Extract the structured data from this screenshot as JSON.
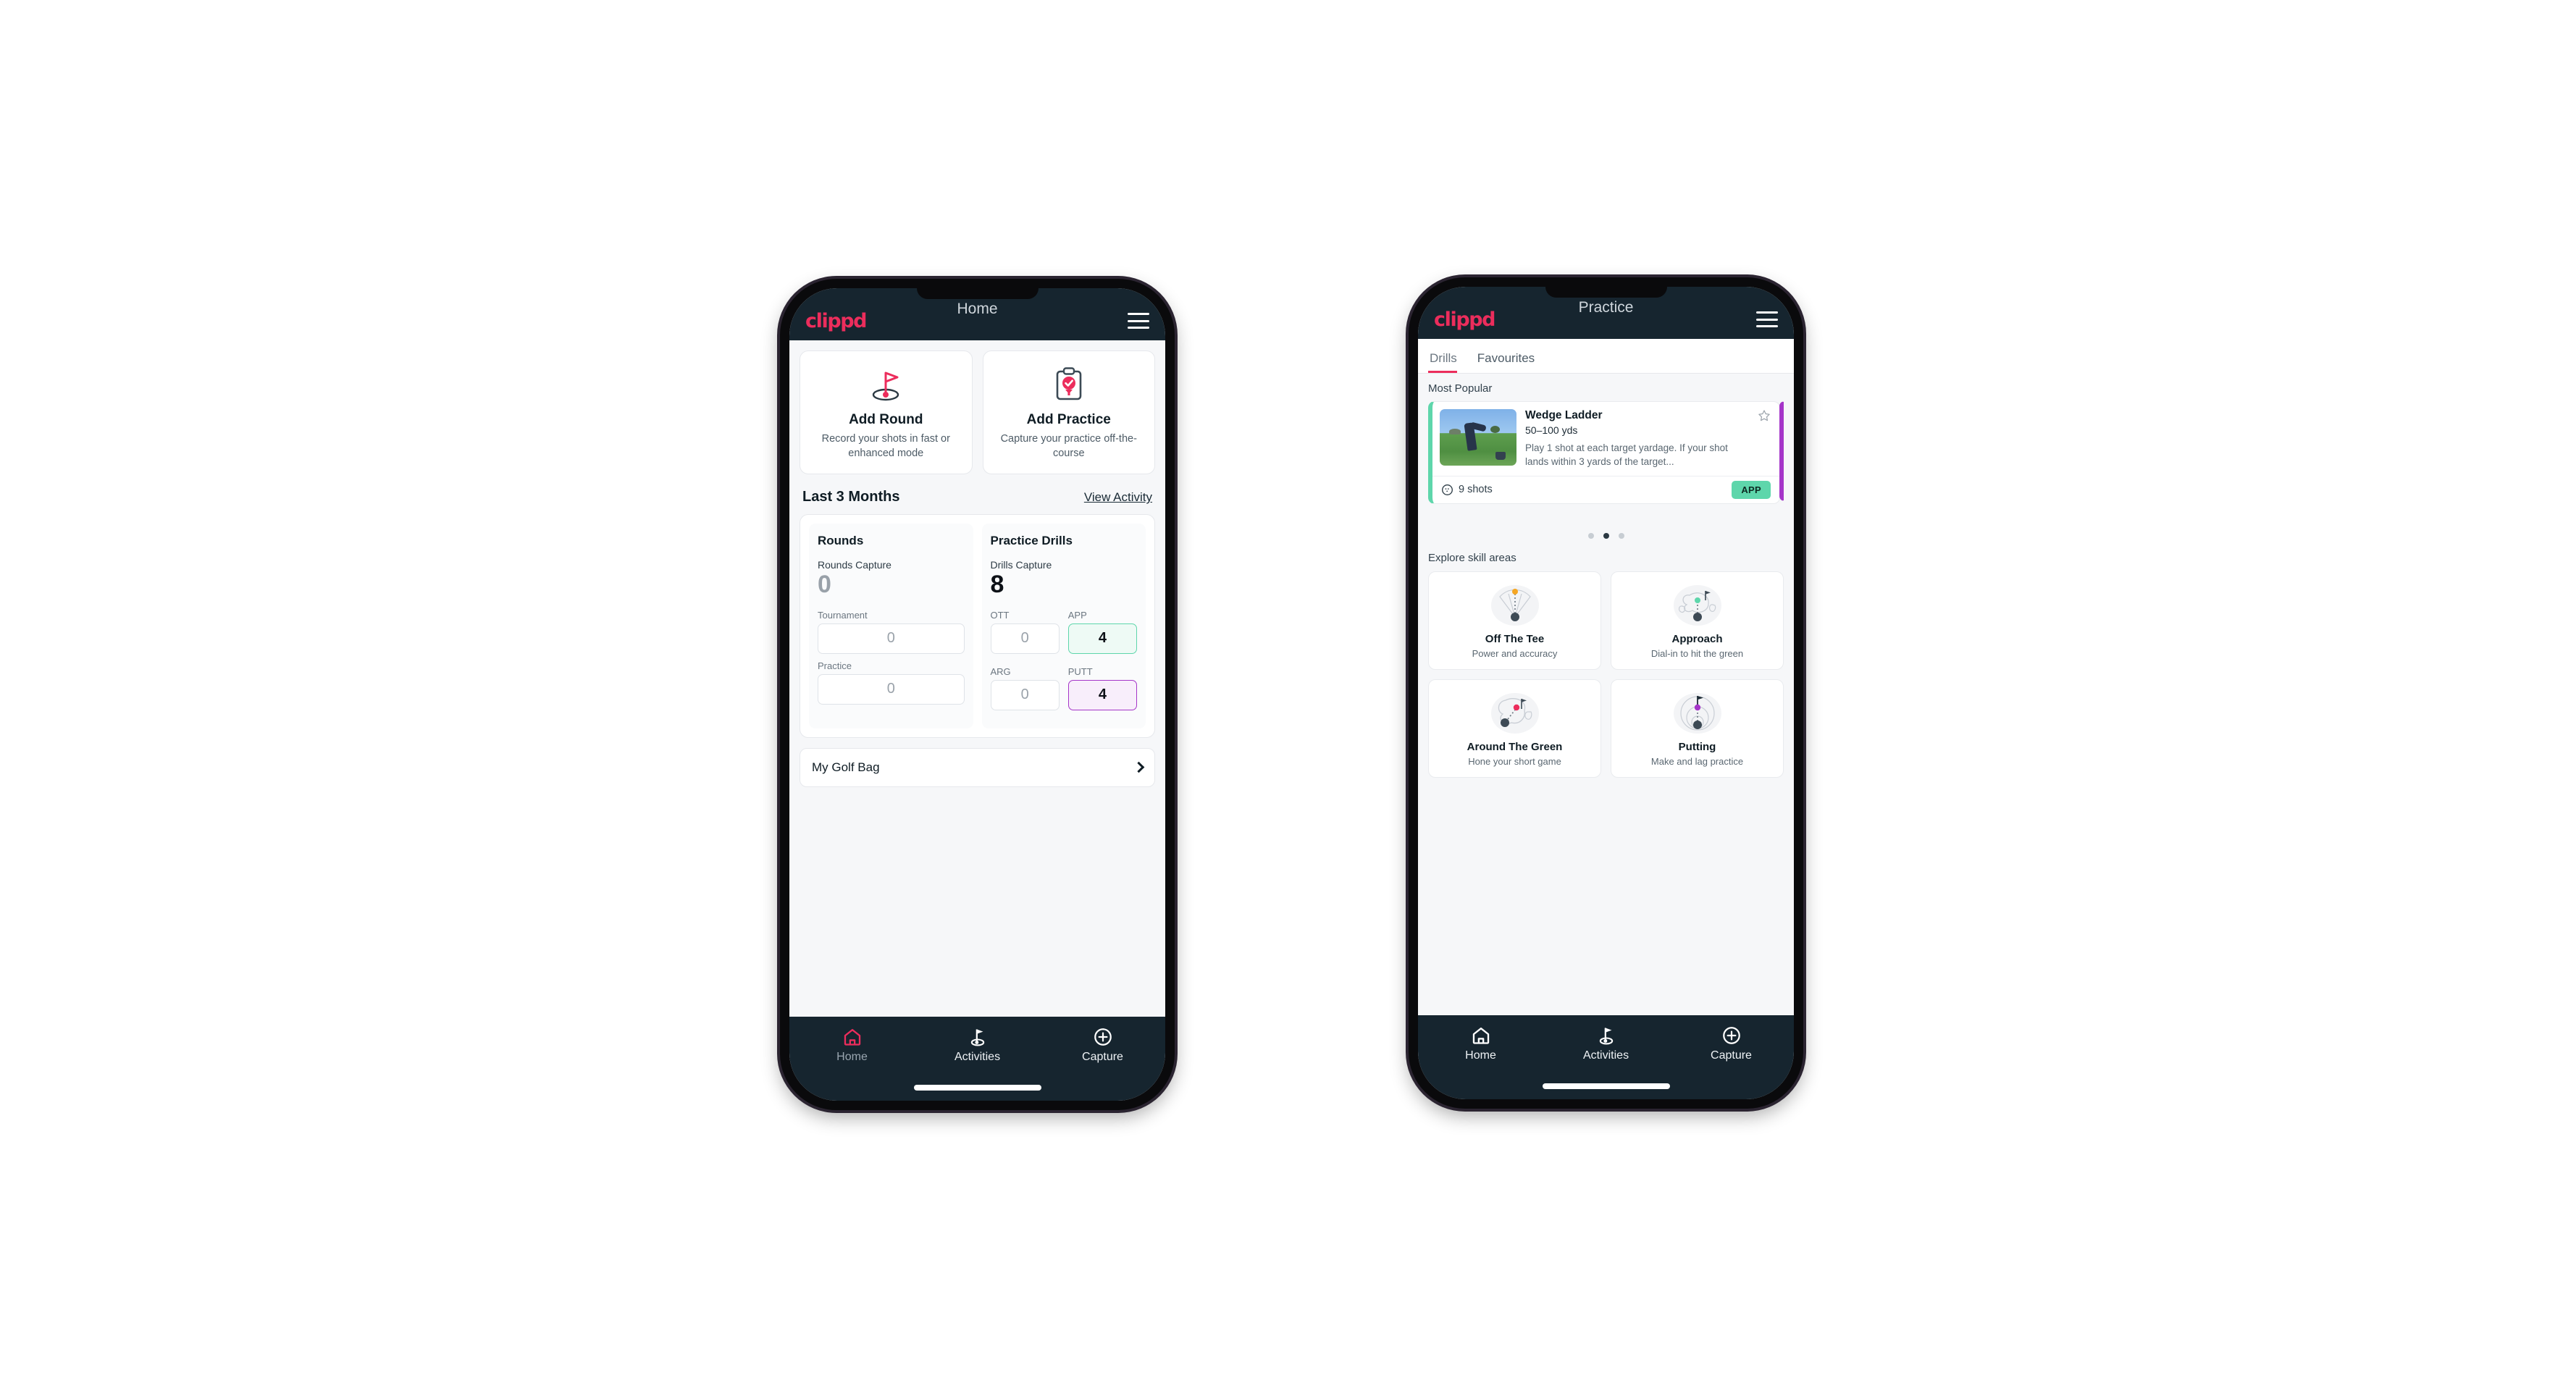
{
  "colors": {
    "brand_pink": "#ec2d5c",
    "appbar_dark": "#16252f",
    "accent_green": "#5ed6ab",
    "accent_purple": "#a535c9",
    "page_bg": "#f6f7f9"
  },
  "home": {
    "appbar": {
      "logo": "clippd",
      "title": "Home",
      "menu_icon": "hamburger-icon"
    },
    "quick_actions": [
      {
        "icon": "golf-flag-icon",
        "title": "Add Round",
        "subtitle": "Record your shots in fast or enhanced mode"
      },
      {
        "icon": "clipboard-check-icon",
        "title": "Add Practice",
        "subtitle": "Capture your practice off-the-course"
      }
    ],
    "section": {
      "title": "Last 3 Months",
      "link": "View Activity"
    },
    "rounds": {
      "heading": "Rounds",
      "capture_label": "Rounds Capture",
      "capture_value": "0",
      "fields": [
        {
          "label": "Tournament",
          "value": "0",
          "accent": "none"
        },
        {
          "label": "Practice",
          "value": "0",
          "accent": "none"
        }
      ]
    },
    "drills": {
      "heading": "Practice Drills",
      "capture_label": "Drills Capture",
      "capture_value": "8",
      "fields": [
        {
          "label": "OTT",
          "value": "0",
          "accent": "none"
        },
        {
          "label": "APP",
          "value": "4",
          "accent": "green"
        },
        {
          "label": "ARG",
          "value": "0",
          "accent": "none"
        },
        {
          "label": "PUTT",
          "value": "4",
          "accent": "purple"
        }
      ]
    },
    "golf_bag": {
      "label": "My Golf Bag",
      "icon": "chevron-right-icon"
    },
    "bottom_nav": [
      {
        "label": "Home",
        "icon": "home-icon",
        "active": true
      },
      {
        "label": "Activities",
        "icon": "golf-flag-icon",
        "active": false
      },
      {
        "label": "Capture",
        "icon": "plus-circle-icon",
        "active": false
      }
    ]
  },
  "practice": {
    "appbar": {
      "logo": "clippd",
      "title": "Practice",
      "menu_icon": "hamburger-icon"
    },
    "tabs": [
      {
        "label": "Drills",
        "active": true
      },
      {
        "label": "Favourites",
        "active": false
      }
    ],
    "most_popular_label": "Most Popular",
    "drill": {
      "title": "Wedge Ladder",
      "range": "50–100 yds",
      "description": "Play 1 shot at each target yardage. If your shot lands within 3 yards of the target...",
      "shots": "9 shots",
      "shots_icon": "golf-ball-icon",
      "badge": "APP",
      "favourite_icon": "star-outline-icon",
      "thumbnail": "golfer-chipping-photo",
      "accent": "#5ed6ab",
      "next_card_accent": "#a535c9"
    },
    "carousel_dots": {
      "count": 3,
      "active_index": 1
    },
    "skill_section_label": "Explore skill areas",
    "skill_areas": [
      {
        "name": "Off The Tee",
        "subtitle": "Power and accuracy",
        "icon": "tee-shot-fan-icon",
        "dot_color": "#f5a623"
      },
      {
        "name": "Approach",
        "subtitle": "Dial-in to hit the green",
        "icon": "green-approach-icon",
        "dot_color": "#5ed6ab"
      },
      {
        "name": "Around The Green",
        "subtitle": "Hone your short game",
        "icon": "chip-shot-icon",
        "dot_color": "#ec2d5c"
      },
      {
        "name": "Putting",
        "subtitle": "Make and lag practice",
        "icon": "putting-rings-icon",
        "dot_color": "#a535c9"
      }
    ],
    "bottom_nav": [
      {
        "label": "Home",
        "icon": "home-icon",
        "active": false
      },
      {
        "label": "Activities",
        "icon": "golf-flag-icon",
        "active": false
      },
      {
        "label": "Capture",
        "icon": "plus-circle-icon",
        "active": false
      }
    ]
  }
}
